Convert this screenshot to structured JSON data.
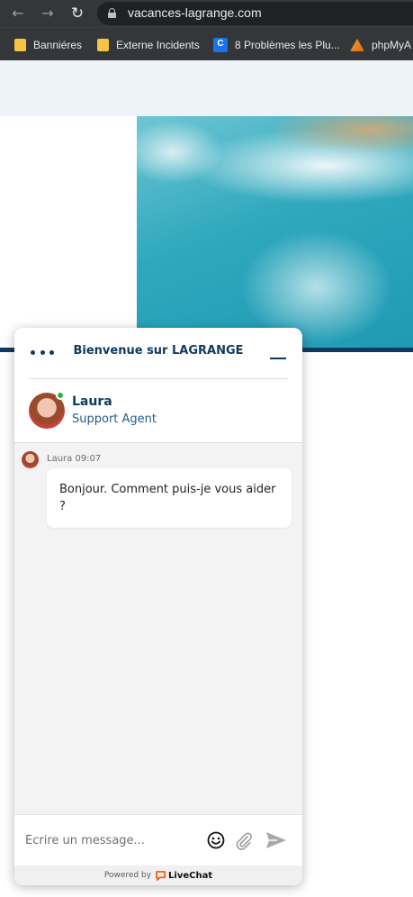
{
  "browser": {
    "url": "vacances-lagrange.com",
    "bookmarks": [
      {
        "label": "Banniéres",
        "icon": "folder-icon"
      },
      {
        "label": "Externe Incidents",
        "icon": "folder-icon"
      },
      {
        "label": "8 Problèmes les Plu...",
        "icon": "c-site-icon"
      },
      {
        "label": "phpMyA",
        "icon": "phpmyadmin-icon"
      }
    ]
  },
  "chat": {
    "title": "Bienvenue sur LAGRANGE",
    "agent": {
      "name": "Laura",
      "role": "Support Agent"
    },
    "messages": [
      {
        "author": "Laura",
        "time": "09:07",
        "meta": "Laura 09:07",
        "text": "Bonjour. Comment puis-je vous aider ?"
      }
    ],
    "composer": {
      "placeholder": "Écrire un message..."
    },
    "footer": {
      "powered_by": "Powered by",
      "brand": "LiveChat"
    }
  },
  "colors": {
    "brand_navy": "#0f3a5f",
    "online": "#2bb24c",
    "livechat_orange": "#ff5100"
  }
}
